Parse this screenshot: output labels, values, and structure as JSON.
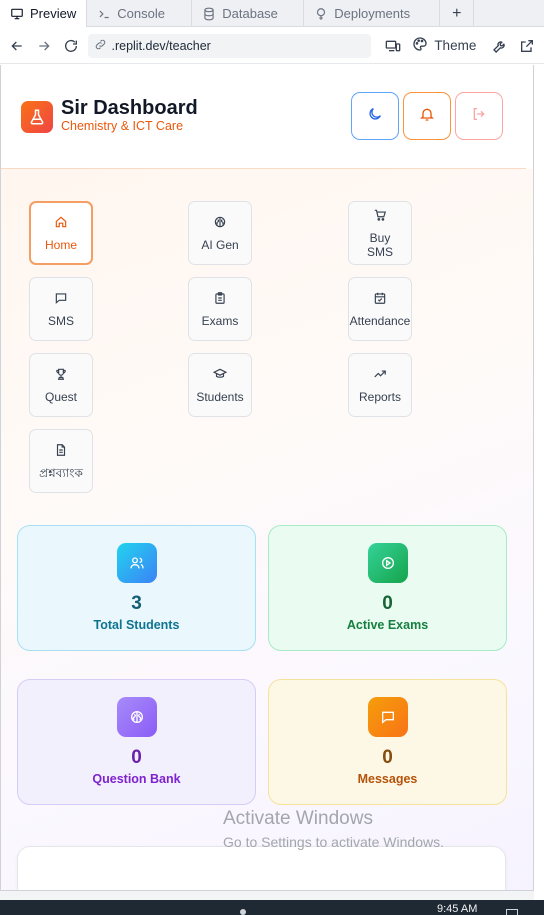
{
  "browser": {
    "tabs": [
      {
        "label": "Preview",
        "icon": "monitor-icon"
      },
      {
        "label": "Console",
        "icon": "terminal-icon"
      },
      {
        "label": "Database",
        "icon": "database-icon"
      },
      {
        "label": "Deployments",
        "icon": "deploy-icon"
      }
    ],
    "add_tab": "+",
    "url": ".replit.dev/teacher",
    "theme_label": "Theme"
  },
  "header": {
    "title": "Sir Dashboard",
    "subtitle": "Chemistry & ICT Care"
  },
  "nav": [
    {
      "label": "Home",
      "icon": "home-icon",
      "active": true
    },
    {
      "label": "AI Gen",
      "icon": "brain-icon"
    },
    {
      "label": "Buy\nSMS",
      "icon": "cart-icon"
    },
    {
      "label": "SMS",
      "icon": "message-icon"
    },
    {
      "label": "Exams",
      "icon": "clipboard-icon"
    },
    {
      "label": "Attendance",
      "icon": "calendar-check-icon"
    },
    {
      "label": "Quest",
      "icon": "trophy-icon"
    },
    {
      "label": "Students",
      "icon": "graduation-cap-icon"
    },
    {
      "label": "Reports",
      "icon": "trending-up-icon"
    },
    {
      "label": "প্রশ্নব্যাংক",
      "icon": "file-text-icon"
    }
  ],
  "stats": {
    "students": {
      "value": "3",
      "label": "Total Students"
    },
    "exams": {
      "value": "0",
      "label": "Active Exams"
    },
    "qbank": {
      "value": "0",
      "label": "Question Bank"
    },
    "messages": {
      "value": "0",
      "label": "Messages"
    }
  },
  "watermark": {
    "title": "Activate Windows",
    "subtitle": "Go to Settings to activate Windows."
  },
  "taskbar": {
    "time": "9:45 AM"
  },
  "colors": {
    "accent": "#ea580c",
    "brand_gradient_start": "#f97316",
    "brand_gradient_end": "#ef4444"
  }
}
